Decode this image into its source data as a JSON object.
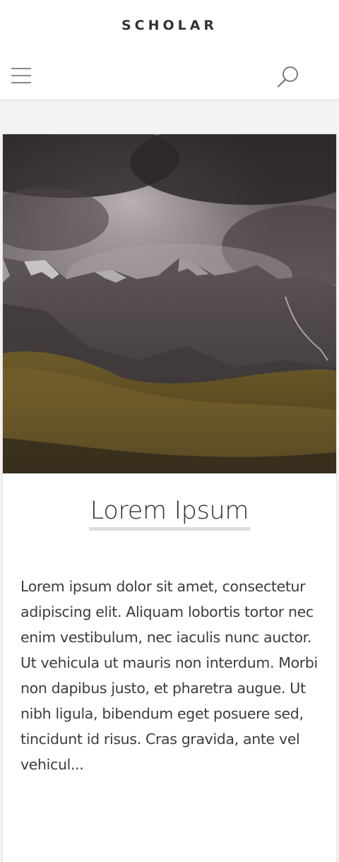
{
  "header": {
    "site_title": "SCHOLAR",
    "menu_icon": "hamburger-menu-icon",
    "search_icon": "search-icon"
  },
  "post": {
    "image_alt": "Mountain landscape under stormy clouds",
    "title": "Lorem Ipsum",
    "excerpt": "Lorem ipsum dolor sit amet, consectetur adipiscing elit. Aliquam lobortis tortor nec enim vestibulum, nec iaculis nunc auctor. Ut vehicula ut mauris non interdum. Morbi non dapibus justo, et pharetra augue. Ut nibh ligula, bibendum eget posuere sed, tincidunt id risus. Cras gravida, ante vel vehicul..."
  },
  "colors": {
    "header_bg": "#ffffff",
    "page_bg": "#f3f3f3",
    "title_underline": "#dcdcdc",
    "text": "#3c3c3c"
  }
}
